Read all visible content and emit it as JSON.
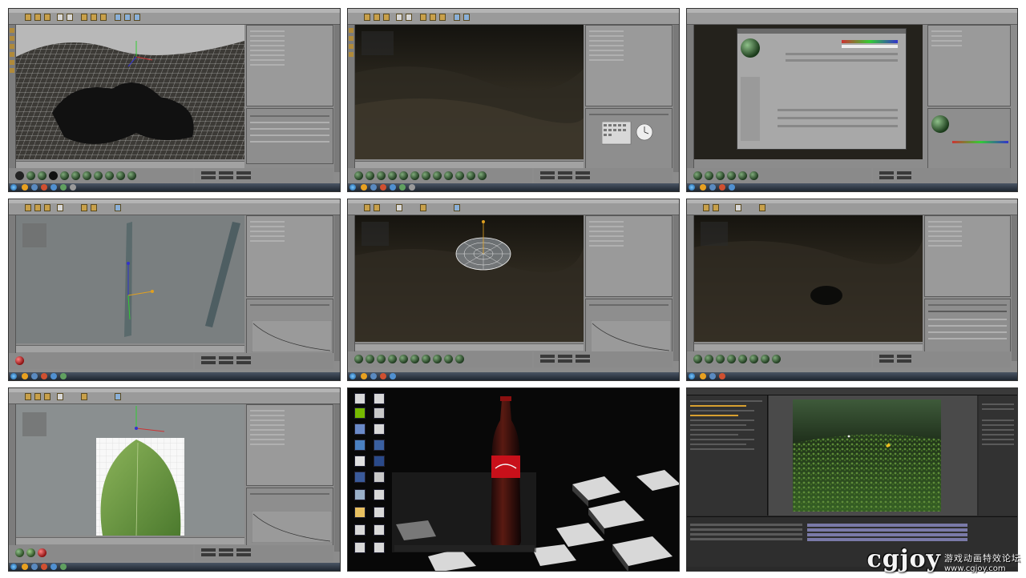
{
  "watermark": {
    "logo": "cgjoy",
    "tagline": "游戏动画特效论坛",
    "url": "www.cgjoy.com"
  },
  "colors": {
    "ui_gray": "#8c8c8c",
    "viewport_dark": "#2c2a24",
    "viewport_gray": "#7d8385",
    "taskbar": "#1e2630",
    "accent_orange": "#c8a04a",
    "grass_green": "#4a7a36",
    "bottle_red": "#c8101a",
    "after_effects_bg": "#2a2a2a"
  },
  "tiles": [
    {
      "id": 1,
      "app": "Cinema 4D",
      "scene": "wireframe landscape terrain"
    },
    {
      "id": 2,
      "app": "Cinema 4D",
      "scene": "dark terrain with sky and time settings"
    },
    {
      "id": 3,
      "app": "Cinema 4D",
      "scene": "material editor dialog"
    },
    {
      "id": 4,
      "app": "Cinema 4D",
      "scene": "blade planes with axis"
    },
    {
      "id": 5,
      "app": "Cinema 4D",
      "scene": "disc emitter over terrain"
    },
    {
      "id": 6,
      "app": "Cinema 4D",
      "scene": "dark terrain with scattered objects"
    },
    {
      "id": 7,
      "app": "Cinema 4D",
      "scene": "leaf texture on plane"
    },
    {
      "id": 8,
      "app": "Windows Desktop",
      "scene": "coca-cola bottle on cubes"
    },
    {
      "id": 9,
      "app": "After Effects",
      "scene": "grass field composition"
    }
  ]
}
